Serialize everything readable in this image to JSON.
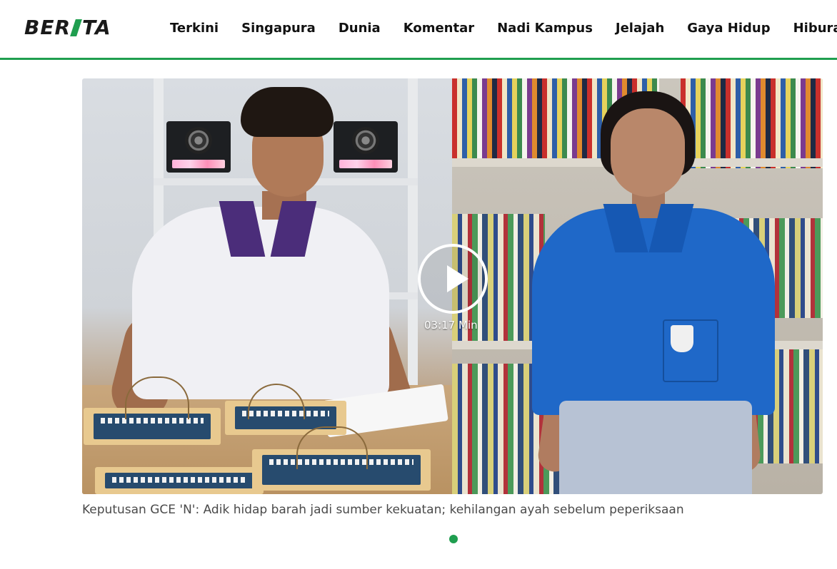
{
  "header": {
    "logo": "BERITA",
    "nav": [
      {
        "label": "Terkini"
      },
      {
        "label": "Singapura"
      },
      {
        "label": "Dunia"
      },
      {
        "label": "Komentar"
      },
      {
        "label": "Nadi Kampus"
      },
      {
        "label": "Jelajah"
      },
      {
        "label": "Gaya Hidup"
      },
      {
        "label": "Hiburan"
      }
    ]
  },
  "hero": {
    "duration": "03:17 Min",
    "play_icon": "play-icon",
    "caption": "Keputusan GCE 'N': Adik hidap barah jadi sumber kekuatan; kehilangan ayah sebelum peperiksaan"
  },
  "carousel": {
    "active_index": 1,
    "dot_count": 1
  },
  "colors": {
    "accent": "#1f9e4f",
    "logo_text": "#1a1a1a",
    "caption": "#4a4a4a"
  }
}
